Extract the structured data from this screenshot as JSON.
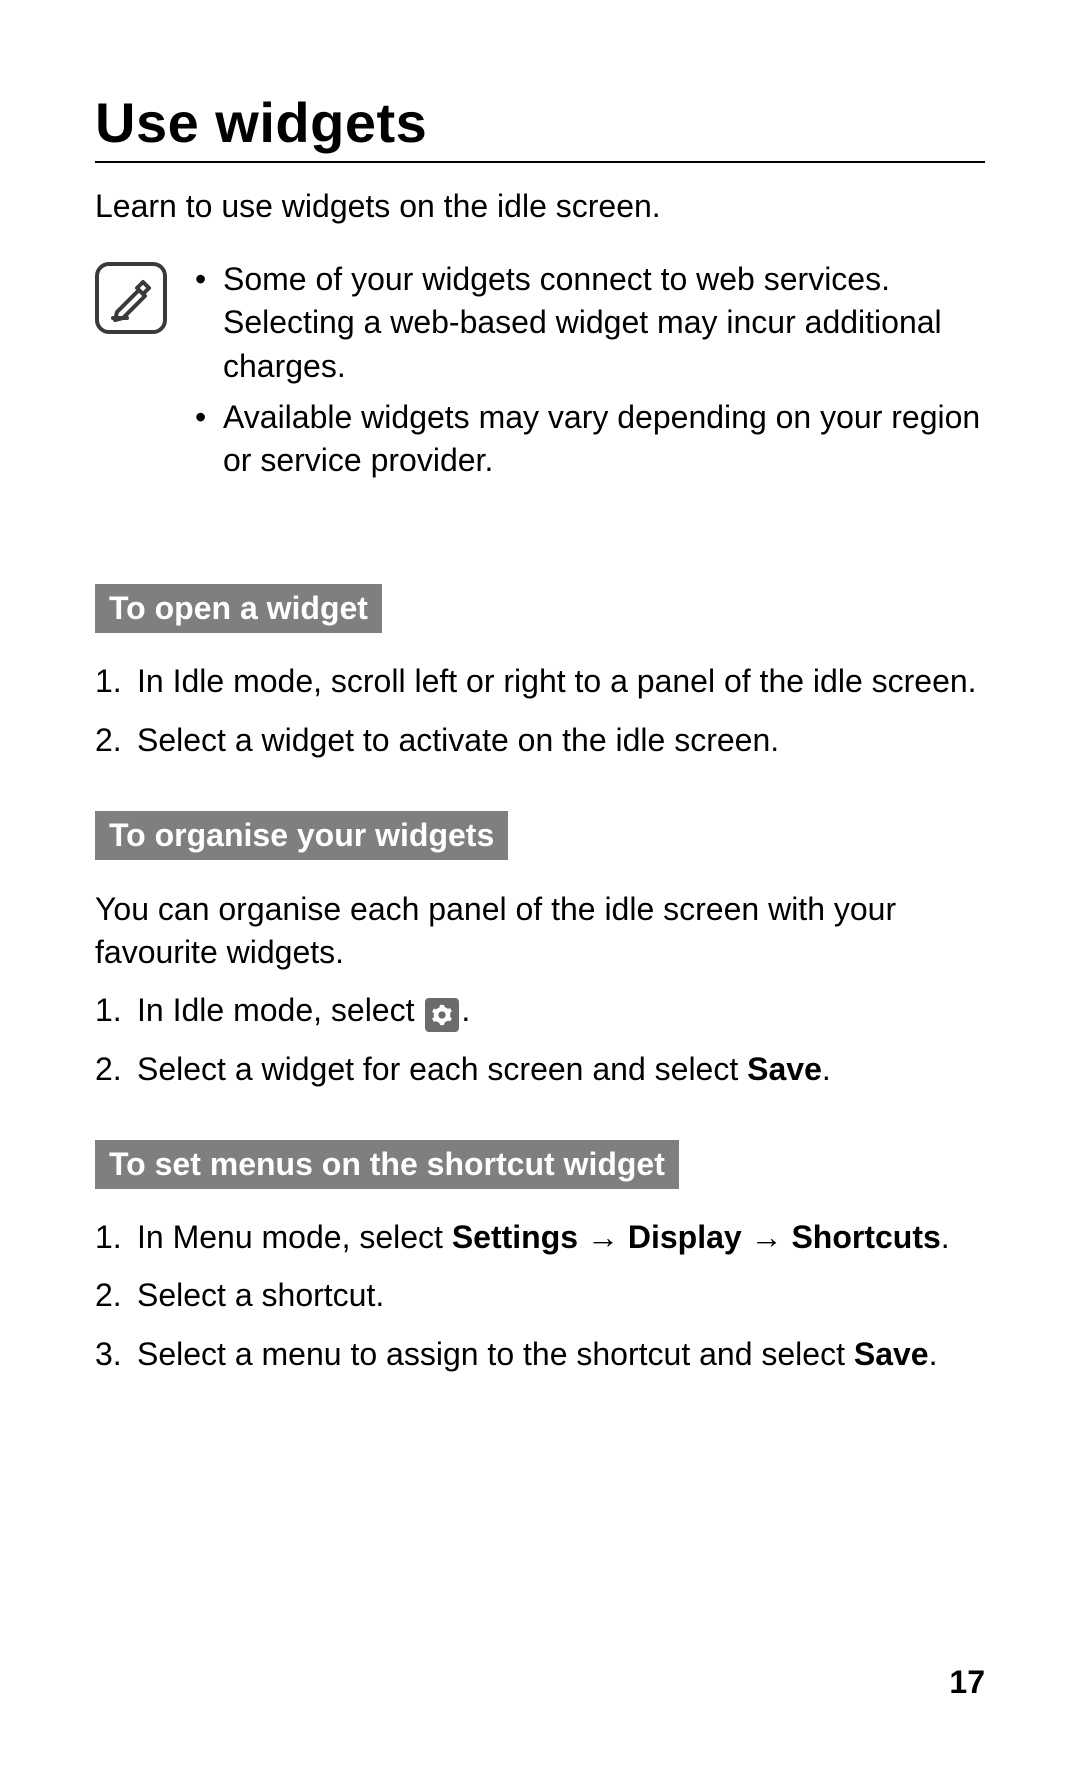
{
  "title": "Use widgets",
  "intro": "Learn to use widgets on the idle screen.",
  "notes": [
    "Some of your widgets connect to web services. Selecting a web-based widget may incur additional charges.",
    "Available widgets may vary depending on your region or service provider."
  ],
  "sections": {
    "open": {
      "label": "To open a widget",
      "steps": [
        "In Idle mode, scroll left or right to a panel of the idle screen.",
        "Select a widget to activate on the idle screen."
      ]
    },
    "organise": {
      "label": "To organise your widgets",
      "intro": "You can organise each panel of the idle screen with your favourite widgets.",
      "step1_prefix": "In Idle mode, select ",
      "step1_suffix": ".",
      "step2_prefix": "Select a widget for each screen and select ",
      "step2_bold": "Save",
      "step2_suffix": "."
    },
    "shortcut": {
      "label": "To set menus on the shortcut widget",
      "step1_prefix": "In Menu mode, select ",
      "step1_b1": "Settings",
      "step1_arrow": " → ",
      "step1_b2": "Display",
      "step1_b3": "Shortcuts",
      "step1_suffix": ".",
      "step2": "Select a shortcut.",
      "step3_prefix": "Select a menu to assign to the shortcut and select ",
      "step3_bold": "Save",
      "step3_suffix": "."
    }
  },
  "page_number": "17"
}
